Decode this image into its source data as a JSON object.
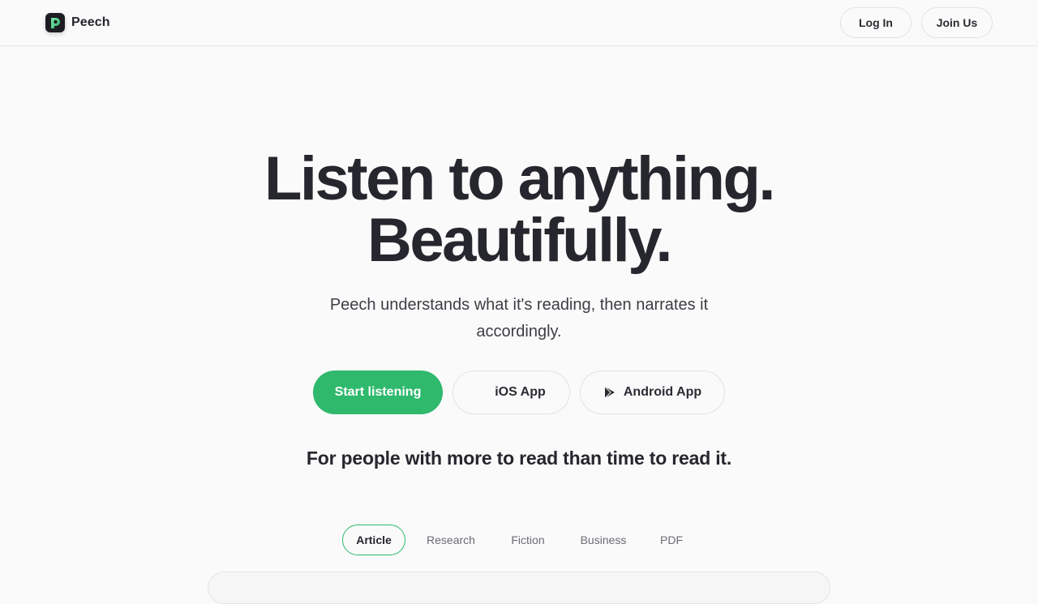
{
  "header": {
    "brand": "Peech",
    "login_label": "Log In",
    "join_label": "Join Us"
  },
  "hero": {
    "title_line1": "Listen to anything.",
    "title_line2": "Beautifully.",
    "subtitle": "Peech understands what it's reading, then narrates it accordingly.",
    "cta_start": "Start listening",
    "cta_ios": "iOS App",
    "cta_android": "Android App",
    "tagline": "For people with more to read than time to read it."
  },
  "tabs": [
    {
      "label": "Article",
      "active": true
    },
    {
      "label": "Research",
      "active": false
    },
    {
      "label": "Fiction",
      "active": false
    },
    {
      "label": "Business",
      "active": false
    },
    {
      "label": "PDF",
      "active": false
    }
  ],
  "colors": {
    "accent": "#2fb96d",
    "text": "#26272e",
    "background": "#fafafa"
  },
  "icons": {
    "brand_logo": "peech-logo-icon",
    "android": "play-store-icon"
  }
}
